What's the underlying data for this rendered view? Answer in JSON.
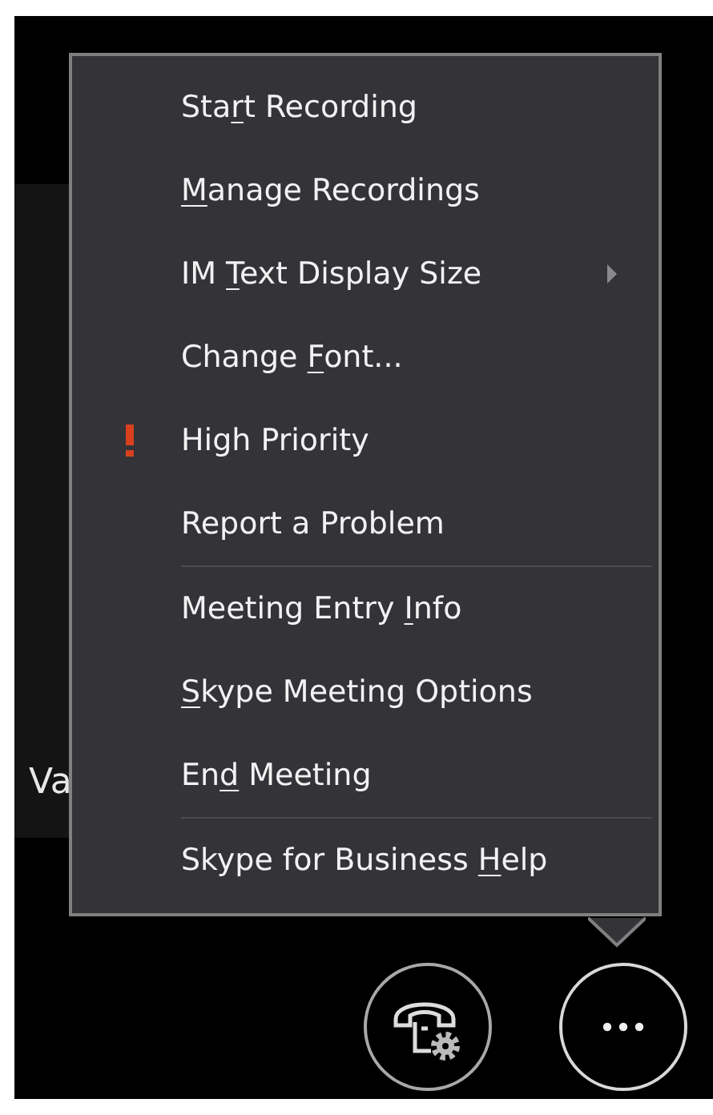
{
  "background_panel": {
    "text": "Va"
  },
  "menu": {
    "groups": [
      [
        {
          "label_before": "Sta",
          "access_key": "r",
          "label_after": "t Recording",
          "flagged": false,
          "submenu": false
        },
        {
          "access_key": "M",
          "label_after": "anage Recordings",
          "flagged": false,
          "submenu": false
        },
        {
          "label_before": "IM ",
          "access_key": "T",
          "label_after": "ext Display Size",
          "flagged": false,
          "submenu": true
        },
        {
          "label_before": "Change ",
          "access_key": "F",
          "label_after": "ont...",
          "flagged": false,
          "submenu": false
        },
        {
          "label_before": "High Priority",
          "flagged": true,
          "submenu": false
        },
        {
          "label_before": "Report a Problem",
          "flagged": false,
          "submenu": false
        }
      ],
      [
        {
          "label_before": "Meeting Entry ",
          "access_key": "I",
          "label_after": "nfo",
          "flagged": false,
          "submenu": false
        },
        {
          "access_key": "S",
          "label_after": "kype Meeting Options",
          "flagged": false,
          "submenu": false
        },
        {
          "label_before": "En",
          "access_key": "d",
          "label_after": " Meeting",
          "flagged": false,
          "submenu": false
        }
      ],
      [
        {
          "label_before": "Skype for Business ",
          "access_key": "H",
          "label_after": "elp",
          "flagged": false,
          "submenu": false
        }
      ]
    ]
  },
  "toolbar": [
    {
      "kind": "call-settings",
      "selected": false
    },
    {
      "kind": "more",
      "selected": true
    }
  ]
}
